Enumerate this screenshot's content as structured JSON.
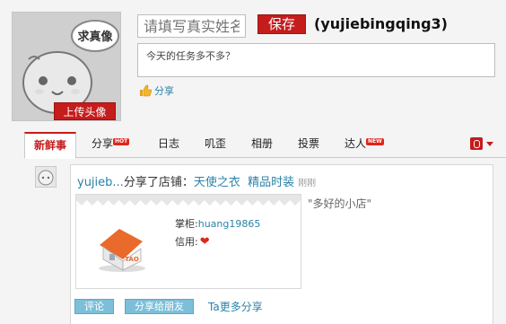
{
  "profile": {
    "avatar_stamp": "求真像",
    "upload_label": "上传头像",
    "name_placeholder": "请填写真实姓名",
    "save_label": "保存",
    "username": "(yujiebingqing3)",
    "status_text": "今天的任务多不多？",
    "share_label": "分享"
  },
  "tabs": [
    {
      "label": "新鲜事",
      "active": true
    },
    {
      "label": "分享",
      "badge": "HOT"
    },
    {
      "label": "日志"
    },
    {
      "label": "叽歪"
    },
    {
      "label": "相册"
    },
    {
      "label": "投票"
    },
    {
      "label": "达人",
      "badge": "NEW"
    }
  ],
  "feed": {
    "user": "yujieb...",
    "action": "分享了店铺：",
    "shop_name": "天使之衣",
    "shop_tag": "精品时装",
    "time": "刚刚",
    "keeper_label": "掌柜:",
    "keeper_name": "huang19865",
    "credit_label": "信用:",
    "quote": "\"多好的小店\"",
    "shop_badge": "TAO",
    "buttons": {
      "comment": "评论",
      "share_friends": "分享给朋友",
      "more_share": "Ta更多分享"
    }
  },
  "colors": {
    "brand_red": "#c51c1c",
    "link_blue": "#2a82a8",
    "button_blue": "#7dbfd9"
  }
}
